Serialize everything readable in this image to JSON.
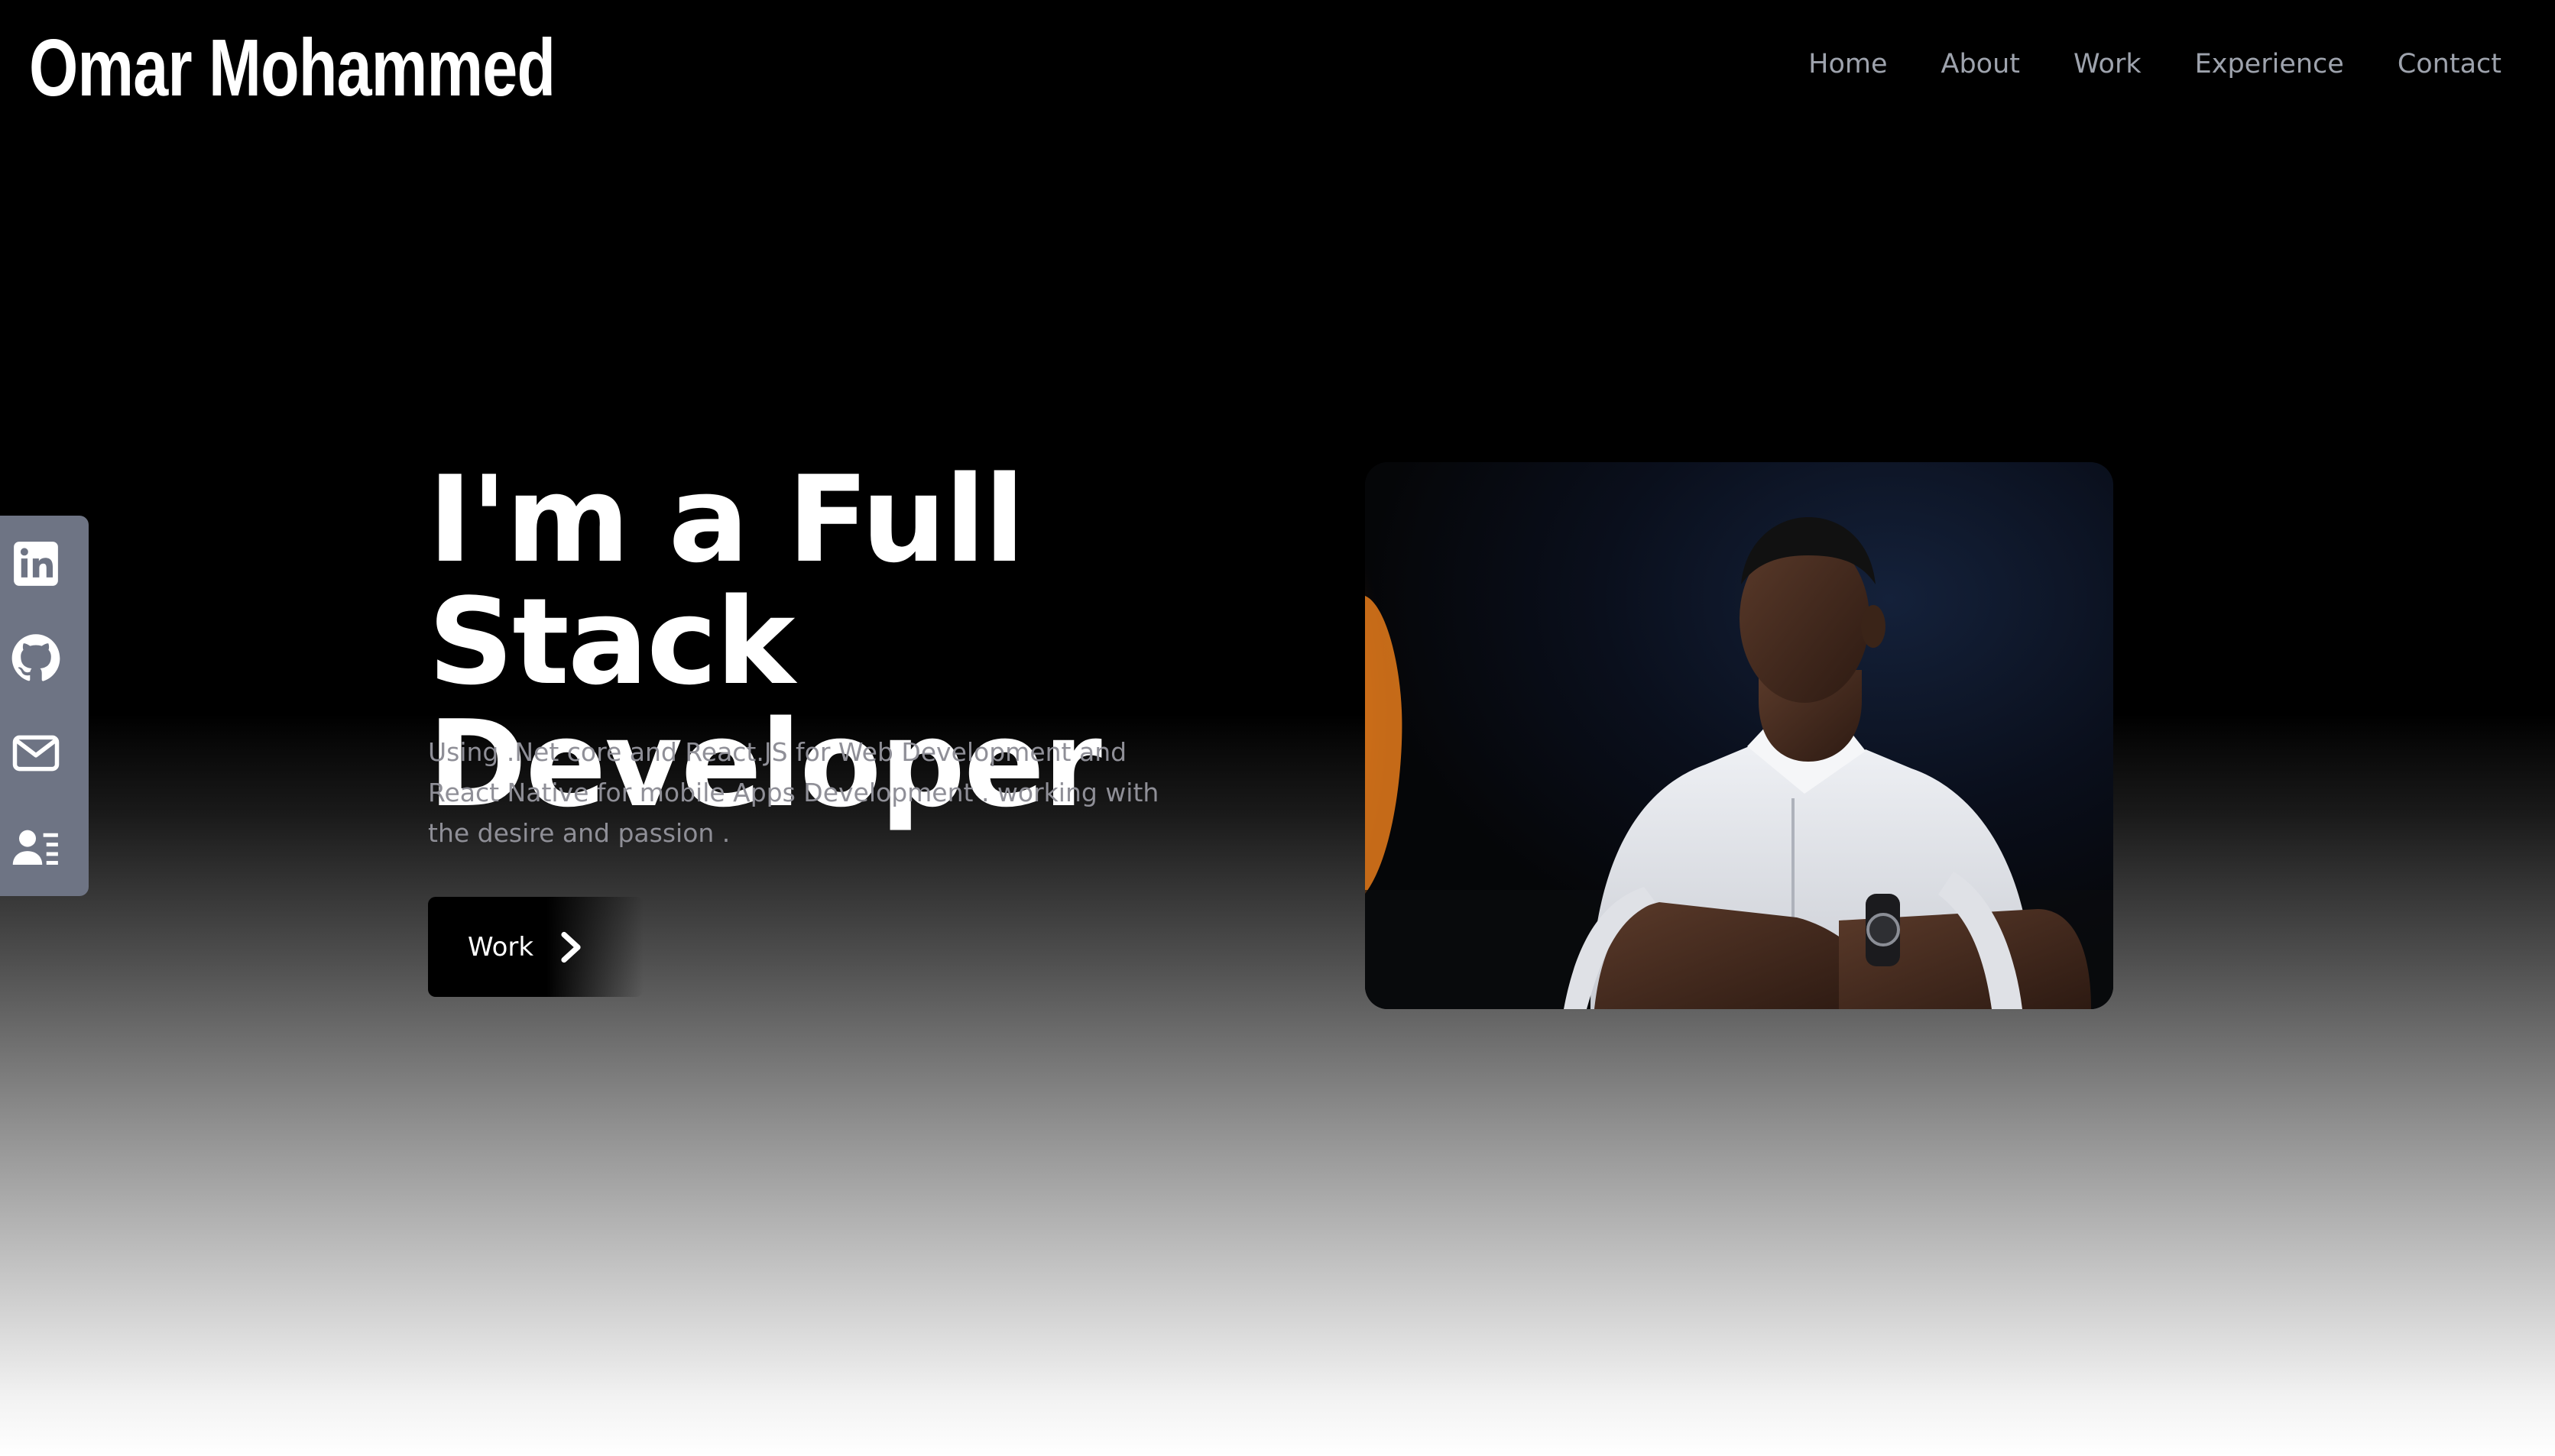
{
  "header": {
    "brand": "Omar Mohammed",
    "nav": [
      {
        "label": "Home"
      },
      {
        "label": "About"
      },
      {
        "label": "Work"
      },
      {
        "label": "Experience"
      },
      {
        "label": "Contact"
      }
    ]
  },
  "social": {
    "items": [
      {
        "icon": "linkedin-icon"
      },
      {
        "icon": "github-icon"
      },
      {
        "icon": "mail-icon"
      },
      {
        "icon": "contact-card-icon"
      }
    ]
  },
  "hero": {
    "title_line1": "I'm a Full Stack",
    "title_line2": "Developer",
    "subtitle": "Using .Net core and React.JS for Web Development and React Native for mobile Apps Development . working with the desire and passion .",
    "button_label": "Work",
    "button_icon": "chevron-right-icon"
  },
  "colors": {
    "background_top": "#000000",
    "background_bottom": "#ffffff",
    "nav_text": "#9ea3ad",
    "subtitle_text": "#8f8f97",
    "social_bar": "#6e7484",
    "accent_light": "#ffffff"
  }
}
